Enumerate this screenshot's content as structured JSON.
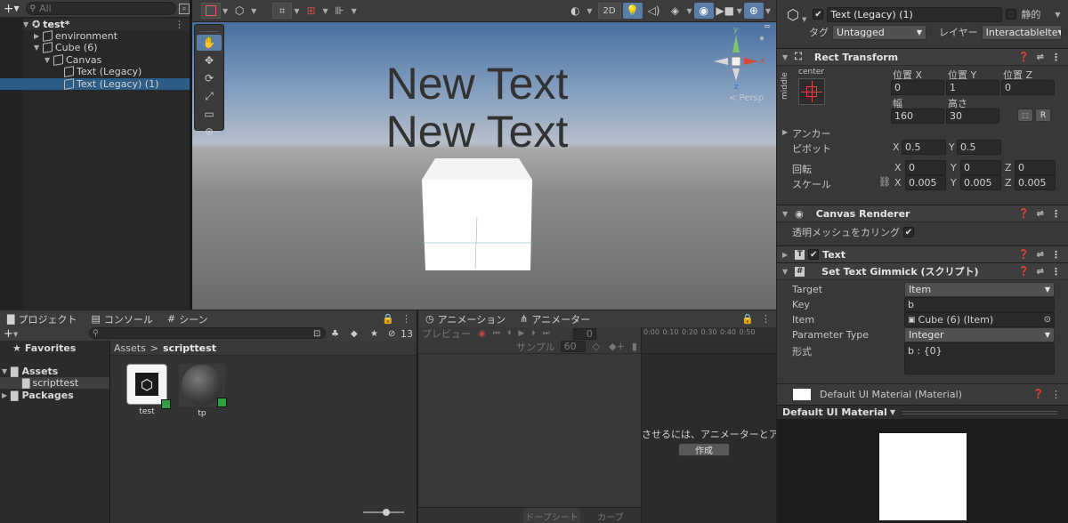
{
  "hierarchy": {
    "add_label": "+",
    "search_placeholder": "All",
    "scene_name": "test*",
    "items": [
      {
        "label": "environment",
        "indent": 1,
        "arrow": "▶"
      },
      {
        "label": "Cube (6)",
        "indent": 1,
        "arrow": "▼"
      },
      {
        "label": "Canvas",
        "indent": 2,
        "arrow": "▼"
      },
      {
        "label": "Text (Legacy)",
        "indent": 3,
        "arrow": ""
      },
      {
        "label": "Text (Legacy) (1)",
        "indent": 3,
        "arrow": "",
        "selected": true
      }
    ]
  },
  "scene": {
    "mode_2d": "2D",
    "text_line1": "New Text",
    "text_line2": "New Text",
    "persp_label": "< Persp",
    "gizmo_y": "y",
    "gizmo_x": "x",
    "gizmo_z": "z"
  },
  "inspector": {
    "object_name": "Text (Legacy) (1)",
    "static_label": "静的",
    "tag_label": "タグ",
    "tag_value": "Untagged",
    "layer_label": "レイヤー",
    "layer_value": "InteractableIte",
    "rect_transform": {
      "title": "Rect Transform",
      "anchor_preset_top": "center",
      "anchor_preset_side": "middle",
      "pos_x_label": "位置 X",
      "pos_y_label": "位置 Y",
      "pos_z_label": "位置 Z",
      "pos_x": "0",
      "pos_y": "1",
      "pos_z": "0",
      "width_label": "幅",
      "height_label": "高さ",
      "width": "160",
      "height": "30",
      "r_label": "R",
      "anchor_label": "アンカー",
      "pivot_label": "ピボット",
      "pivot_x": "0.5",
      "pivot_y": "0.5",
      "rotation_label": "回転",
      "rot_x": "0",
      "rot_y": "0",
      "rot_z": "0",
      "scale_label": "スケール",
      "scale_x": "0.005",
      "scale_y": "0.005",
      "scale_z": "0.005",
      "x": "X",
      "y": "Y",
      "z": "Z"
    },
    "canvas_renderer": {
      "title": "Canvas Renderer",
      "cull_label": "透明メッシュをカリング"
    },
    "text": {
      "title": "Text"
    },
    "gimmick": {
      "title": "Set Text Gimmick (スクリプト)",
      "target_label": "Target",
      "target_value": "Item",
      "key_label": "Key",
      "key_value": "b",
      "item_label": "Item",
      "item_value": "Cube (6) (Item)",
      "ptype_label": "Parameter Type",
      "ptype_value": "Integer",
      "format_label": "形式",
      "format_value": "b : {0}"
    },
    "material": {
      "title": "Default UI Material (Material)",
      "preview_label": "Default UI Material"
    }
  },
  "project": {
    "tab_project": "プロジェクト",
    "tab_console": "コンソール",
    "tab_scene": "シーン",
    "favorites": "Favorites",
    "assets": "Assets",
    "scripttest": "scripttest",
    "packages": "Packages",
    "breadcrumb_root": "Assets",
    "breadcrumb_sep": ">",
    "breadcrumb_leaf": "scripttest",
    "hidden_count": "13",
    "files": [
      {
        "name": "test"
      },
      {
        "name": "tp"
      }
    ]
  },
  "animation": {
    "tab_animation": "アニメーション",
    "tab_animator": "アニメーター",
    "preview_label": "プレビュー",
    "frame_value": "0",
    "sample_label": "サンプル",
    "sample_value": "60",
    "timeline_ticks": [
      "0:00",
      "0:10",
      "0:20",
      "0:30",
      "0:40",
      "0:50"
    ],
    "message": "させるには、アニメーターとア",
    "create_label": "作成",
    "dopesheet_label": "ドープシート",
    "curves_label": "カーブ"
  }
}
